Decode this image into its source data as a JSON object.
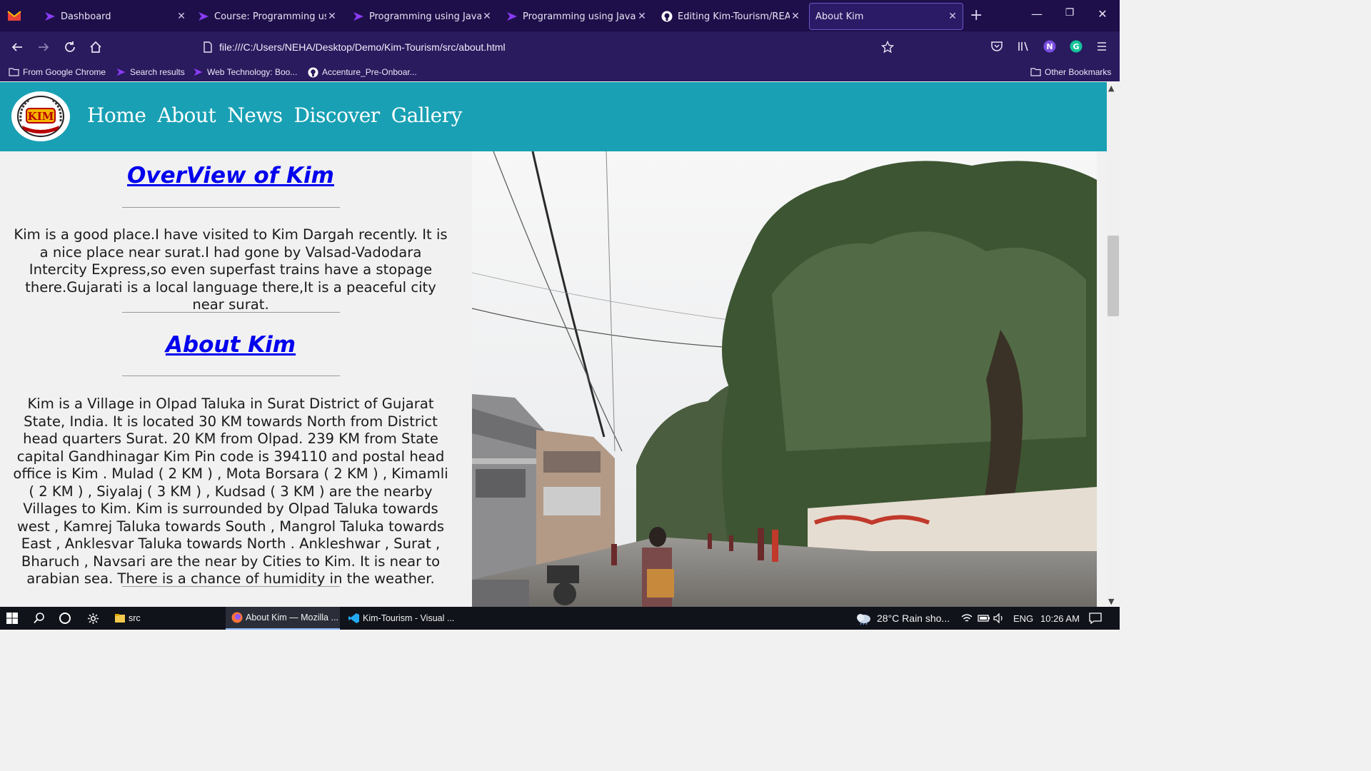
{
  "browser": {
    "tabs": [
      {
        "label": "Dashboard",
        "icon": "course-site-icon"
      },
      {
        "label": "Course: Programming using J",
        "icon": "course-site-icon"
      },
      {
        "label": "Programming using Java Con",
        "icon": "course-site-icon"
      },
      {
        "label": "Programming using Java Mo",
        "icon": "course-site-icon"
      },
      {
        "label": "Editing Kim-Tourism/READM",
        "icon": "github-icon"
      },
      {
        "label": "About Kim",
        "icon": "none",
        "active": true
      }
    ],
    "url": "file:///C:/Users/NEHA/Desktop/Demo/Kim-Tourism/src/about.html",
    "bookmarks": [
      {
        "label": "From Google Chrome",
        "icon": "folder-icon"
      },
      {
        "label": "Search results",
        "icon": "course-site-icon"
      },
      {
        "label": "Web Technology: Boo...",
        "icon": "course-site-icon"
      },
      {
        "label": "Accenture_Pre-Onboar...",
        "icon": "github-icon"
      }
    ],
    "other_bookmarks": "Other Bookmarks",
    "profile_initial": "N",
    "grammarly_initial": "G",
    "accent_color": "#1e0f4a"
  },
  "site": {
    "logo_text": "KIM",
    "nav": [
      "Home",
      "About",
      "News",
      "Discover",
      "Gallery"
    ],
    "header_color": "#19a0b4",
    "overview_title": "OverView of Kim",
    "overview_text": "Kim is a good place.I have visited to Kim Dargah recently. It is a nice place near surat.I had gone by Valsad-Vadodara Intercity Express,so even superfast trains have a stopage there.Gujarati is a local language there,It is a peaceful city near surat.",
    "about_title": "About Kim",
    "about_text": "Kim is a Village in Olpad Taluka in Surat District of Gujarat State, India. It is located 30 KM towards North from District head quarters Surat. 20 KM from Olpad. 239 KM from State capital Gandhinagar Kim Pin code is 394110 and postal head office is Kim . Mulad ( 2 KM ) , Mota Borsara ( 2 KM ) , Kimamli ( 2 KM ) , Siyalaj ( 3 KM ) , Kudsad ( 3 KM ) are the nearby Villages to Kim. Kim is surrounded by Olpad Taluka towards west , Kamrej Taluka towards South , Mangrol Taluka towards East , Anklesvar Taluka towards North . Ankleshwar , Surat , Bharuch , Navsari are the near by Cities to Kim. It is near to arabian sea. There is a chance of humidity in the weather."
  },
  "taskbar": {
    "apps": [
      {
        "label": "src",
        "icon": "folder-icon"
      },
      {
        "label": "About Kim — Mozilla ...",
        "icon": "firefox-icon",
        "active": true
      },
      {
        "label": "Kim-Tourism - Visual ...",
        "icon": "vscode-icon"
      }
    ],
    "weather": "28°C  Rain sho...",
    "language": "ENG",
    "time": "10:26 AM"
  }
}
